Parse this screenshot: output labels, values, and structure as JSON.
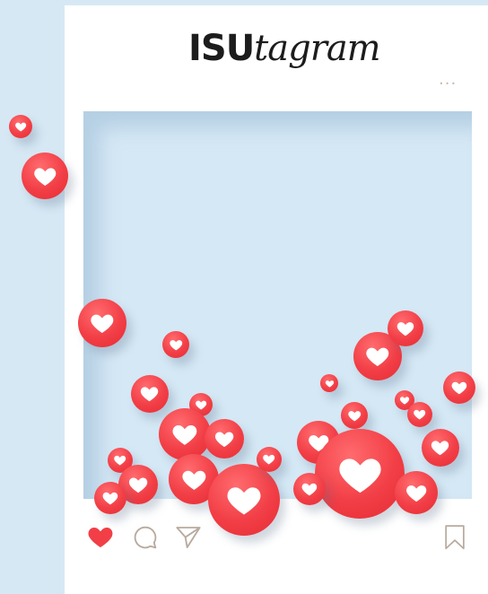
{
  "post": {
    "logo_bold": "ISU",
    "logo_script": "tagram",
    "more_label": "..."
  },
  "actions": {
    "like_icon": "heart-filled-icon",
    "comment_icon": "comment-icon",
    "share_icon": "paper-plane-icon",
    "save_icon": "bookmark-icon"
  },
  "colors": {
    "background": "#d6e8f4",
    "card": "#ffffff",
    "photo": "#d5e8f5",
    "heart_red": "#f23e46",
    "icon_outline": "#b9aa9e",
    "logo": "#1c1c1c"
  }
}
